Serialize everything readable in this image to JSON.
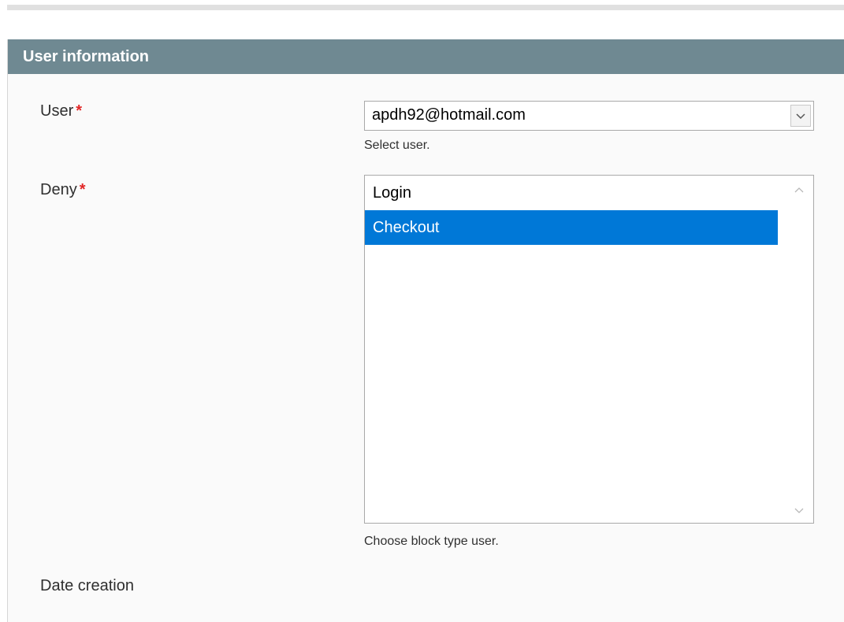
{
  "fieldset": {
    "title": "User information"
  },
  "fields": {
    "user": {
      "label": "User",
      "required_mark": "*",
      "value": "apdh92@hotmail.com",
      "note": "Select user."
    },
    "deny": {
      "label": "Deny",
      "required_mark": "*",
      "options": [
        {
          "label": "Login",
          "selected": false
        },
        {
          "label": "Checkout",
          "selected": true
        }
      ],
      "note": "Choose block type user."
    },
    "date_creation": {
      "label": "Date creation"
    }
  },
  "colors": {
    "header_bg": "#6f8992",
    "required": "#e22626",
    "selection": "#0078d7"
  },
  "icons": {
    "dropdown": "chevron-down-icon",
    "scroll_up": "chevron-up-icon",
    "scroll_down": "chevron-down-icon"
  }
}
